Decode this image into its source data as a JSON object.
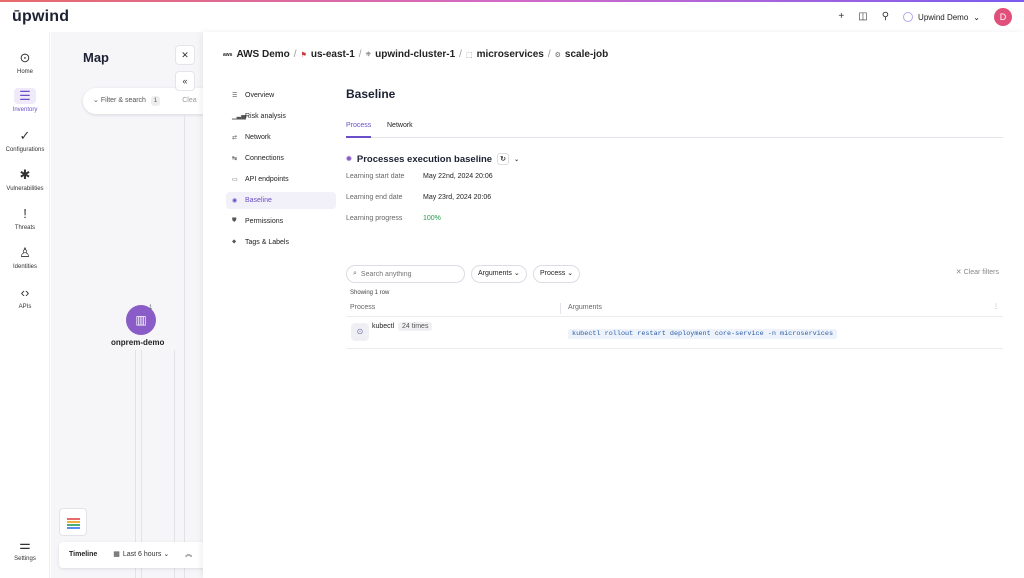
{
  "app": {
    "logo": "ūpwind",
    "workspace": "Upwind Demo",
    "user_initial": "D"
  },
  "header_icons": [
    "plus-icon",
    "book-icon",
    "user-switch-icon"
  ],
  "rail": [
    {
      "label": "Home",
      "icon": "⊙"
    },
    {
      "label": "Inventory",
      "icon": "☰",
      "active": true
    },
    {
      "label": "Configurations",
      "icon": "✓"
    },
    {
      "label": "Vulnerabilities",
      "icon": "✱"
    },
    {
      "label": "Threats",
      "icon": "!"
    },
    {
      "label": "Identities",
      "icon": "♙"
    },
    {
      "label": "APIs",
      "icon": "‹›"
    },
    {
      "label": "Settings",
      "icon": "⚌"
    }
  ],
  "map": {
    "title": "Map",
    "filter_placeholder": "Filter & search",
    "filter_count": "1",
    "clear_label": "Clea",
    "node_label": "onprem-demo",
    "node_badge": "1",
    "timeline_title": "Timeline",
    "timeline_range": "Last 6 hours"
  },
  "breadcrumb": {
    "account": "AWS Demo",
    "region": "us-east-1",
    "cluster": "upwind-cluster-1",
    "namespace": "microservices",
    "workload": "scale-job",
    "account_icon_text": "aws"
  },
  "nav": [
    {
      "label": "Overview",
      "icon": "☰"
    },
    {
      "label": "Risk analysis",
      "icon": "▁▃▅"
    },
    {
      "label": "Network",
      "icon": "⇄"
    },
    {
      "label": "Connections",
      "icon": "↹"
    },
    {
      "label": "API endpoints",
      "icon": "▭"
    },
    {
      "label": "Baseline",
      "icon": "◉",
      "active": true
    },
    {
      "label": "Permissions",
      "icon": "⛊"
    },
    {
      "label": "Tags & Labels",
      "icon": "⬥"
    }
  ],
  "baseline": {
    "title": "Baseline",
    "tabs": [
      "Process",
      "Network"
    ],
    "active_tab": "Process",
    "section_title": "Processes execution baseline",
    "learning_start_label": "Learning start date",
    "learning_start_value": "May 22nd, 2024 20:06",
    "learning_end_label": "Learning end date",
    "learning_end_value": "May 23rd, 2024 20:06",
    "learning_progress_label": "Learning progress",
    "learning_progress_value": "100%",
    "search_placeholder": "Search anything",
    "filter_arguments": "Arguments",
    "filter_process": "Process",
    "clear_filters": "Clear filters",
    "showing": "Showing 1 row",
    "columns": [
      "Process",
      "Arguments"
    ],
    "rows": [
      {
        "process": "kubectl",
        "count": "24 times",
        "arguments": "kubectl rollout restart deployment core-service -n microservices"
      }
    ]
  },
  "colors": {
    "accent": "#6a4fc8",
    "success": "#1e9e4a",
    "avatar": "#e0507a",
    "node": "#8a5cc7"
  }
}
